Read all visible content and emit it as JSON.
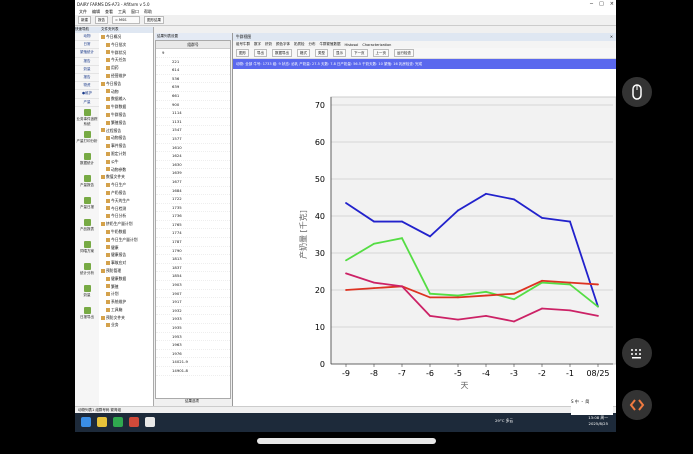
{
  "window": {
    "title": "DAIRY FARMS DS-A73 - Afifarm v 5.0",
    "controls": [
      "─",
      "□",
      "×"
    ]
  },
  "menu": [
    "文件",
    "编辑",
    "查看",
    "工具",
    "窗口",
    "帮助"
  ],
  "toolbar": {
    "new_label": "新建",
    "open_label": "报告",
    "search_value": "= MSS",
    "chart_label": "图形结果"
  },
  "leftnav": {
    "header": "快速导航",
    "items": [
      "动物",
      "日常",
      "繁殖统计",
      "报告",
      "奶量",
      "报告",
      "物资",
      "●维护",
      "产量"
    ],
    "big_items": [
      "业务事件追踪系统",
      "产量打印分析",
      "数据统计",
      "产量报告",
      "产量日报",
      "产品报表",
      "饲喂方案",
      "统计分析",
      "奶量",
      "日报导出"
    ]
  },
  "tree": {
    "header": "文件夹列表",
    "items": [
      "今日概况",
      "今日批次",
      "牛群状况",
      "今天任务",
      "用药",
      "经营维护",
      "今日报告",
      "动物",
      "数据输入",
      "牛群数据",
      "牛群报告",
      "繁殖报告",
      "过程报告",
      "动物报告",
      "事件报告",
      "限定计划",
      "公牛",
      "动物参数",
      "数值文件夹",
      "今日生产",
      "产奶报告",
      "今天的生产",
      "今日检测",
      "今日分析",
      "挤奶生产量计划",
      "牛奶数据",
      "今日生产量计划",
      "健康",
      "健康报告",
      "事故应对",
      "预防管理",
      "健康数据",
      "繁殖",
      "计划",
      "系统维护",
      "工具箱",
      "预防文件夹",
      "业务"
    ]
  },
  "midlist": {
    "panel_title": "结果列表设置",
    "header": "组群号",
    "parent": "9",
    "items": [
      "221",
      "614",
      "536",
      "639",
      "661",
      "900",
      "1114",
      "1131",
      "1547",
      "1577",
      "1610",
      "1624",
      "1630",
      "1639",
      "1677",
      "1684",
      "1722",
      "1735",
      "1736",
      "1765",
      "1774",
      "1787",
      "1790",
      "1813",
      "1837",
      "1854",
      "1903",
      "1907",
      "1917",
      "1932",
      "1933",
      "1935",
      "1953",
      "1963",
      "1976",
      "14021-9",
      "14901-8"
    ],
    "footer": "结果选项"
  },
  "chartwin": {
    "title": "牛群视图",
    "tabs": [
      "组号牛群",
      "数字",
      "挤奶",
      "颜色字体",
      "奶质检",
      "分布",
      "牛群繁殖数据",
      "Histosol",
      "Characterization"
    ],
    "tools": [
      "图形",
      "导出",
      "数据导出",
      "格式",
      "类型",
      "显示",
      "下一页",
      "上一页",
      "运行检查"
    ],
    "info": "动物: 全部  牛号: 1733  组: 9  状态: 泌乳  产奶量: 27.5  天数: 7.8  日产奶量: 56.5  干奶天数: 10  繁殖: 16  乳房检查: 完成"
  },
  "chart_data": {
    "type": "line",
    "categories": [
      "-9",
      "-8",
      "-7",
      "-6",
      "-5",
      "-4",
      "-3",
      "-2",
      "-1",
      "08/25"
    ],
    "ylabel": "产奶量 [千克]",
    "xlabel": "天",
    "ylim": [
      0,
      70
    ],
    "yticks": [
      0,
      10,
      20,
      30,
      40,
      50,
      60,
      70
    ],
    "grid": true,
    "series": [
      {
        "color": "#2222cc",
        "values": [
          43.5,
          38.5,
          38.5,
          34.5,
          41.5,
          46,
          44.5,
          39.5,
          38.5,
          15.5
        ]
      },
      {
        "color": "#55dd44",
        "values": [
          28,
          32.5,
          34,
          19,
          18.5,
          19.5,
          17.5,
          22,
          21.5,
          15.5
        ]
      },
      {
        "color": "#dd3322",
        "values": [
          20,
          20.5,
          21,
          18,
          18,
          18.5,
          19,
          22.5,
          22,
          21.5
        ]
      },
      {
        "color": "#cc2266",
        "values": [
          24.5,
          22,
          21,
          13,
          12,
          13,
          11.5,
          15,
          14.5,
          13
        ]
      }
    ]
  },
  "statusbar": "动物列表1  组群号码  繁育组",
  "taskbar": {
    "weather": "29°C 多云",
    "time": "13:08 周一",
    "date": "2025/8/25"
  },
  "ime": {
    "label": "S 中 ・ 简"
  },
  "colors": {
    "info_bar": "#5a68ee",
    "taskbar": "#1d2a3a",
    "nav_link": "#1a3a8a"
  }
}
